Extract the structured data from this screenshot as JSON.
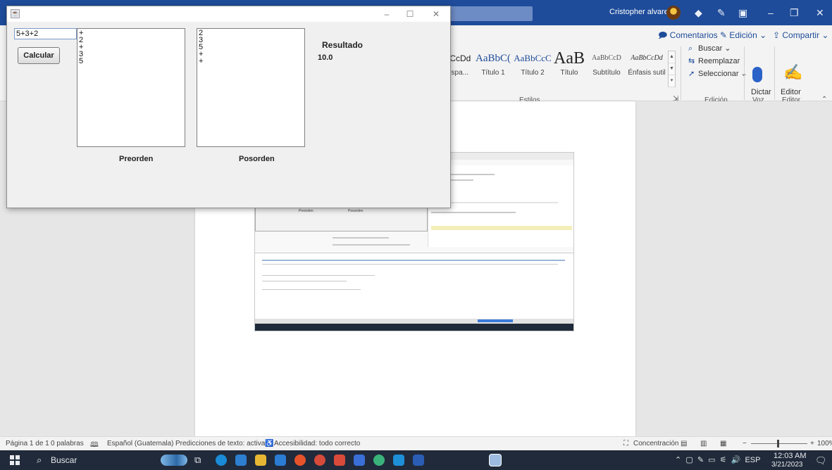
{
  "word": {
    "user_name": "Cristopher alvarez",
    "ribbon": {
      "comentarios": "Comentarios",
      "edicion": "Edición",
      "compartir": "Compartir",
      "styles": [
        {
          "preview": "bCcDd",
          "name": "espa..."
        },
        {
          "preview": "AaBbC(",
          "name": "Título 1"
        },
        {
          "preview": "AaBbCcC",
          "name": "Título 2"
        },
        {
          "preview": "AaB",
          "name": "Título"
        },
        {
          "preview": "AaBbCcD",
          "name": "Subtítulo"
        },
        {
          "preview": "AaBbCcDd",
          "name": "Énfasis sutil"
        }
      ],
      "estilos_group": "Estilos",
      "buscar": "Buscar",
      "reemplazar": "Reemplazar",
      "seleccionar": "Seleccionar",
      "edicion_group": "Edición",
      "dictar": "Dictar",
      "voz_group": "Voz",
      "editor": "Editor",
      "editor_group": "Editor"
    },
    "statusbar": {
      "page": "Página 1 de 1",
      "words": "0 palabras",
      "language": "Español (Guatemala)",
      "predictions": "Predicciones de texto: activado",
      "accessibility": "Accesibilidad: todo correcto",
      "focus": "Concentración",
      "zoom": "100%"
    },
    "embedded_labels": {
      "preorden": "Preorden",
      "posorden": "Posorden"
    }
  },
  "taskbar": {
    "search": "Buscar",
    "language": "ESP",
    "time": "12:03 AM",
    "date": "3/21/2023"
  },
  "java_app": {
    "expression": "5+3+2",
    "calculate_button": "Calcular",
    "preorden": [
      "+",
      "2",
      "+",
      "3",
      "5"
    ],
    "posorden": [
      "2",
      "3",
      "5",
      "+",
      "+"
    ],
    "resultado_label": "Resultado",
    "resultado_value": "10.0",
    "preorden_label": "Preorden",
    "posorden_label": "Posorden"
  },
  "colors": {
    "word_blue": "#1e4c9a",
    "taskbar": "#202a3a"
  }
}
